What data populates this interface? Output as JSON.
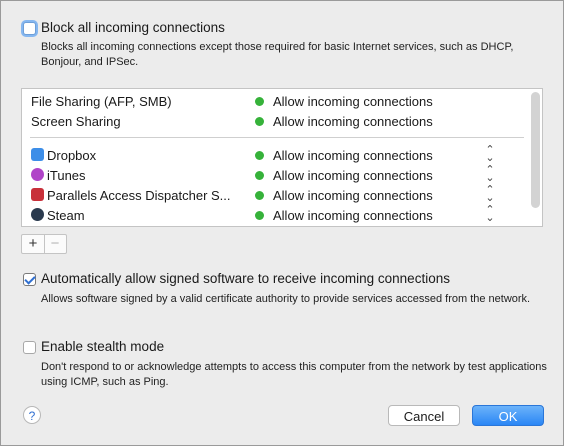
{
  "block_all": {
    "title": "Block all incoming connections",
    "description": "Blocks all incoming connections except those required for basic Internet services,  such as DHCP, Bonjour, and IPSec.",
    "checked": false
  },
  "services": [
    {
      "name": "File Sharing (AFP, SMB)",
      "status": "Allow incoming connections"
    },
    {
      "name": "Screen Sharing",
      "status": "Allow incoming connections"
    }
  ],
  "apps": [
    {
      "name": "Dropbox",
      "icon": "dropbox-icon",
      "status": "Allow incoming connections",
      "color": "#3d8ee8"
    },
    {
      "name": "iTunes",
      "icon": "itunes-icon",
      "status": "Allow incoming connections",
      "color": "#b044c8"
    },
    {
      "name": "Parallels Access Dispatcher S...",
      "icon": "parallels-icon",
      "status": "Allow incoming connections",
      "color": "#c8303a"
    },
    {
      "name": "Steam",
      "icon": "steam-icon",
      "status": "Allow incoming connections",
      "color": "#2a3a4e"
    }
  ],
  "status_color": "#36b23a",
  "list_controls": {
    "add": "+",
    "remove": "−"
  },
  "auto_allow": {
    "title": "Automatically allow signed software to receive incoming connections",
    "description": "Allows software signed by a valid certificate authority to provide services accessed from the network.",
    "checked": true
  },
  "stealth": {
    "title": "Enable stealth mode",
    "description": "Don't respond to or acknowledge attempts to access this computer from the network by test applications using ICMP, such as Ping.",
    "checked": false
  },
  "footer": {
    "help": "?",
    "cancel": "Cancel",
    "ok": "OK"
  }
}
